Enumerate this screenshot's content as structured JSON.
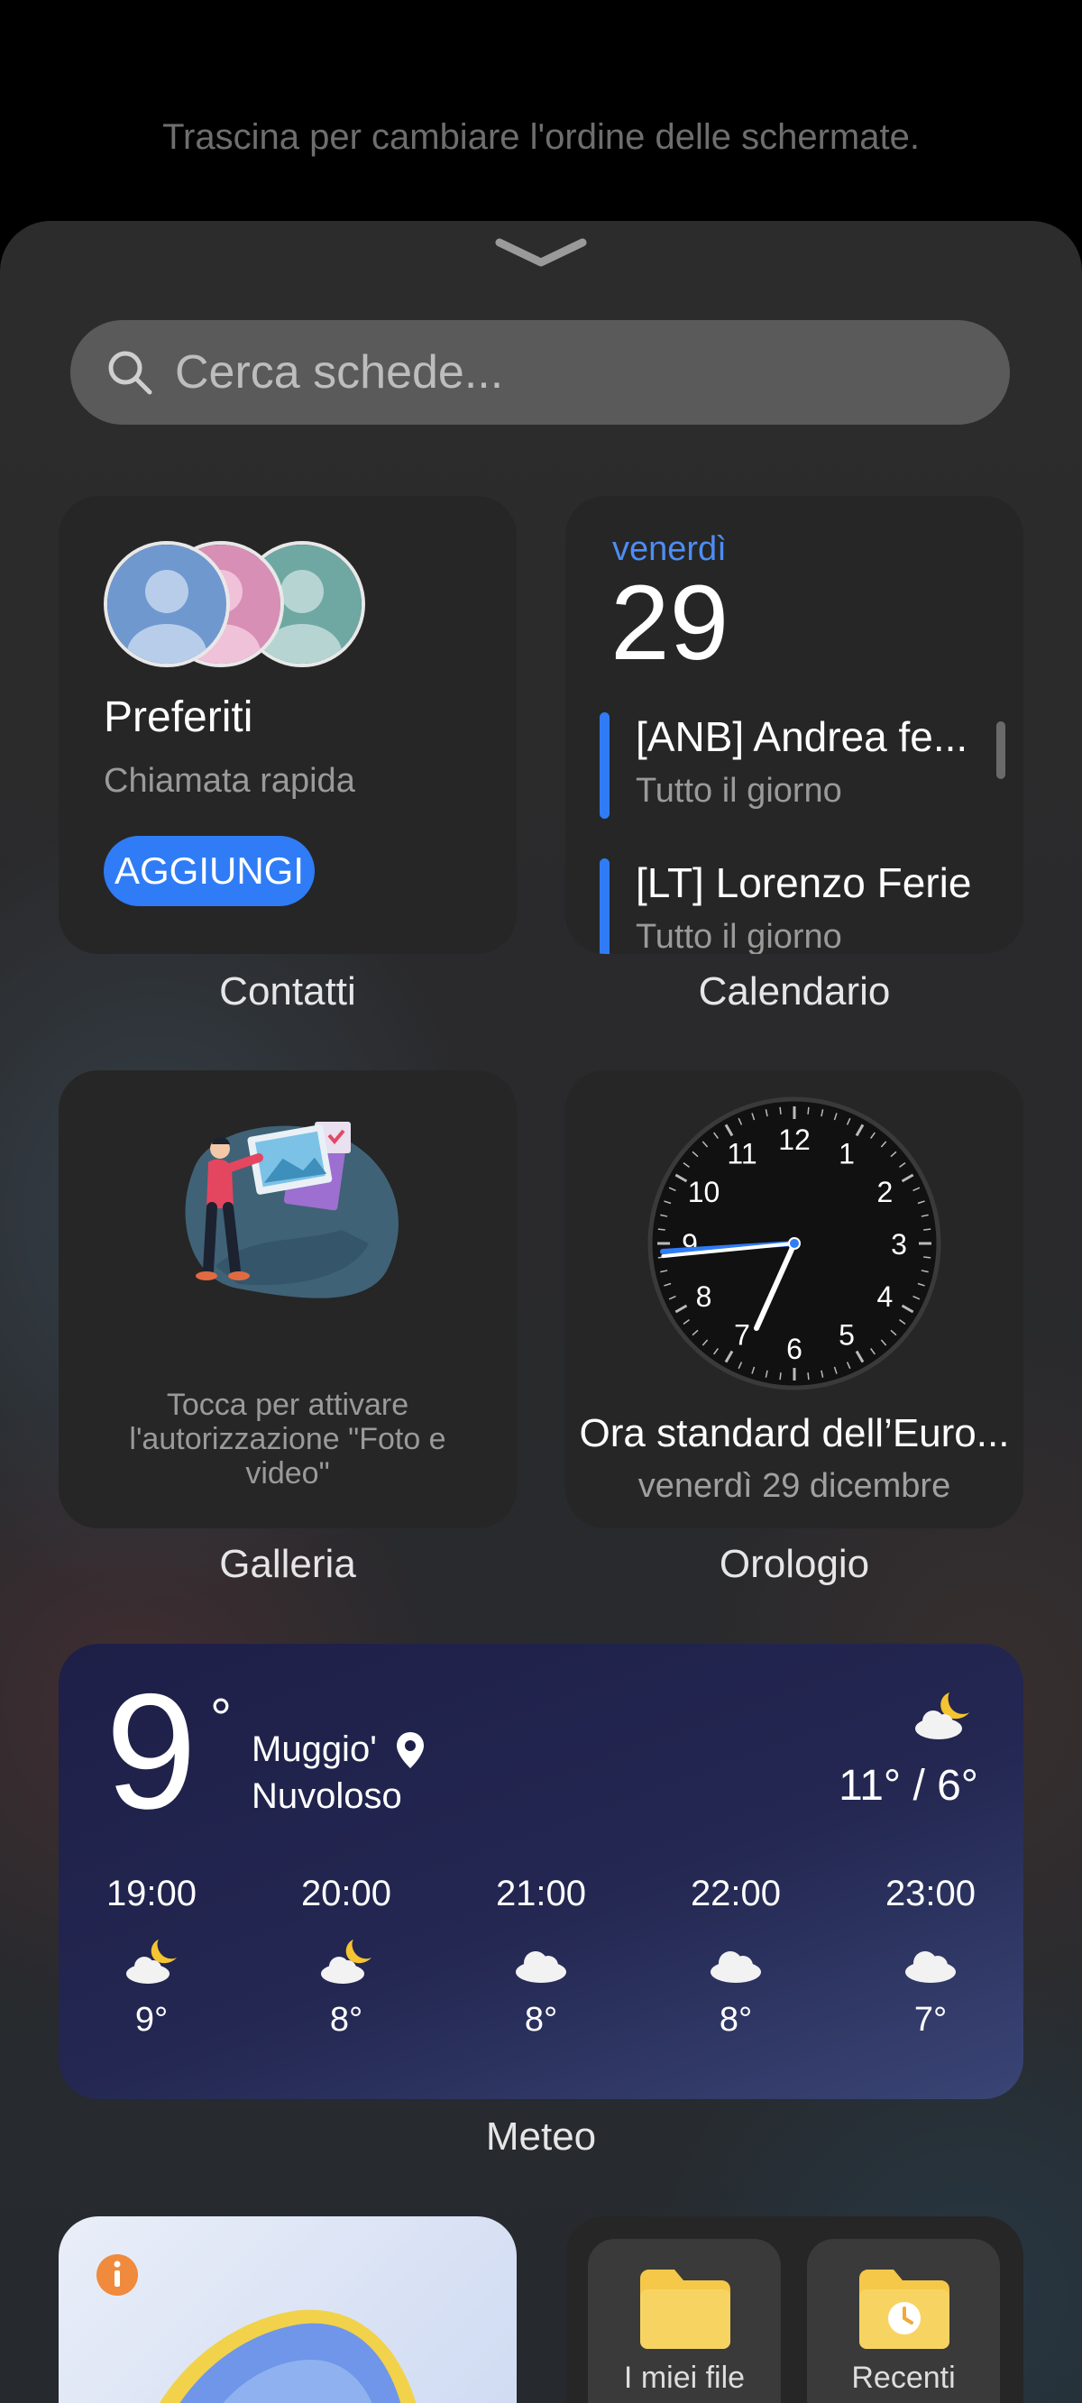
{
  "hint": "Trascina per cambiare l'ordine delle schermate.",
  "search": {
    "placeholder": "Cerca schede..."
  },
  "widgets": {
    "contacts": {
      "title": "Preferiti",
      "subtitle": "Chiamata rapida",
      "button": "AGGIUNGI",
      "label": "Contatti"
    },
    "calendar": {
      "weekday": "venerdì",
      "day": "29",
      "label": "Calendario",
      "events": [
        {
          "title": "[ANB] Andrea fe...",
          "sub": "Tutto il giorno"
        },
        {
          "title": "[LT] Lorenzo Ferie",
          "sub": "Tutto il giorno"
        }
      ]
    },
    "gallery": {
      "message": "Tocca per attivare l'autorizzazione \"Foto e video\"",
      "label": "Galleria"
    },
    "clock": {
      "timezone": "Ora standard dell’Euro...",
      "date": "venerdì 29 dicembre",
      "label": "Orologio",
      "numbers": [
        "12",
        "1",
        "2",
        "3",
        "4",
        "5",
        "6",
        "7",
        "8",
        "9",
        "10",
        "11"
      ]
    },
    "weather": {
      "temp": "9",
      "deg": "°",
      "city": "Muggio'",
      "condition": "Nuvoloso",
      "range": "11° / 6°",
      "label": "Meteo",
      "hours": [
        {
          "time": "19:00",
          "icon": "moon-cloud-icon",
          "temp": "9°"
        },
        {
          "time": "20:00",
          "icon": "moon-cloud-icon",
          "temp": "8°"
        },
        {
          "time": "21:00",
          "icon": "cloud-icon",
          "temp": "8°"
        },
        {
          "time": "22:00",
          "icon": "cloud-icon",
          "temp": "8°"
        },
        {
          "time": "23:00",
          "icon": "cloud-icon",
          "temp": "7°"
        }
      ]
    },
    "files": {
      "tiles": [
        "I miei file",
        "Recenti"
      ]
    }
  },
  "colors": {
    "accent": "#2f7cf6",
    "weather_bg": "#1e1f48"
  }
}
